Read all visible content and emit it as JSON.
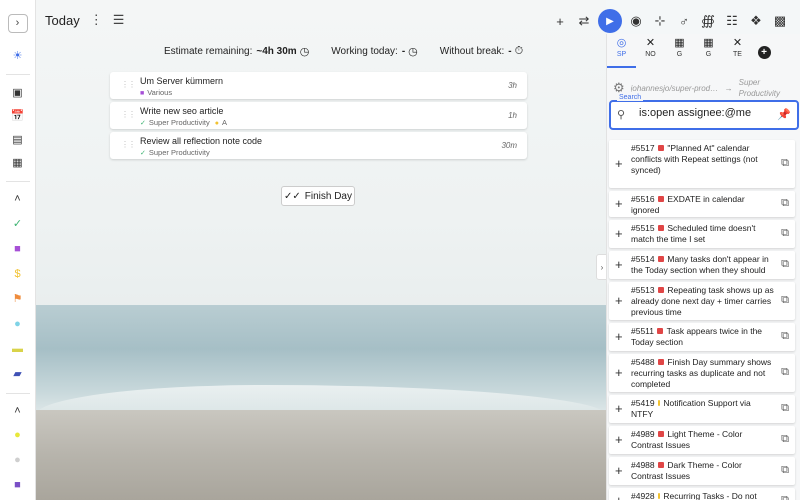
{
  "header": {
    "title": "Today",
    "right_icons": [
      "plus-icon",
      "sync-off-icon",
      "play-icon",
      "focus-mode-icon",
      "walk-icon",
      "meditate-icon",
      "stretch-icon",
      "calendar-sync-icon",
      "plugin-icon",
      "chat-icon"
    ]
  },
  "sidebar": {
    "top": [
      "today-icon",
      "inbox-icon",
      "schedule-icon",
      "planner-icon",
      "boards-icon"
    ],
    "projects": [
      {
        "icon": "check-icon",
        "color": "#3cb371"
      },
      {
        "icon": "folder-icon",
        "color": "#a64fd6"
      },
      {
        "icon": "dollar-icon",
        "color": "#f1c232"
      },
      {
        "icon": "flag-icon",
        "color": "#ef8c3c"
      },
      {
        "icon": "bulb-icon",
        "color": "#7fd3e6"
      },
      {
        "icon": "case-icon",
        "color": "#d9d34a"
      },
      {
        "icon": "car-icon",
        "color": "#3f51b5"
      }
    ],
    "tags": [
      {
        "icon": "tag-icon",
        "color": "#e8e83a"
      },
      {
        "icon": "tag-icon",
        "color": "#cfcfcf"
      },
      {
        "icon": "chat-icon",
        "color": "#7a4fc6"
      }
    ]
  },
  "stats": {
    "estimate_label": "Estimate remaining:",
    "estimate_value": "~4h 30m",
    "working_label": "Working today:",
    "working_value": "-",
    "break_label": "Without break:",
    "break_value": "-"
  },
  "tasks": [
    {
      "title": "Um Server kümmern",
      "tags": [
        {
          "label": "Various",
          "color": "#a64fd6",
          "icon": "folder-icon"
        }
      ],
      "estimate": "3h"
    },
    {
      "title": "Write new seo article",
      "tags": [
        {
          "label": "Super Productivity",
          "color": "#3cb371",
          "icon": "check-icon"
        },
        {
          "label": "A",
          "color": "#f1c232",
          "icon": "tag-icon"
        }
      ],
      "estimate": "1h"
    },
    {
      "title": "Review all reflection note code",
      "tags": [
        {
          "label": "Super Productivity",
          "color": "#3cb371",
          "icon": "check-icon"
        }
      ],
      "estimate": "30m"
    }
  ],
  "finish_day_label": "Finish Day",
  "panel": {
    "providers": [
      {
        "code": "SP",
        "icon": "github-icon",
        "active": true
      },
      {
        "code": "NO",
        "icon": "off-icon",
        "active": false
      },
      {
        "code": "G",
        "icon": "calendar-icon",
        "active": false
      },
      {
        "code": "G",
        "icon": "calendar-icon",
        "active": false
      },
      {
        "code": "TE",
        "icon": "off-icon",
        "active": false
      }
    ],
    "repo": "johannesjo/super-productivity",
    "project": "Super Productivity",
    "search_label": "Search",
    "search_value": "is:open assignee:@me",
    "issues": [
      {
        "text": "#5517 \"Planned At\" calendar conflicts with Repeat settings (not synced)",
        "labels": [
          "#e04646"
        ]
      },
      {
        "text": "#5516 EXDATE in calendar ignored",
        "labels": [
          "#e04646"
        ]
      },
      {
        "text": "#5515 Scheduled time doesn't match the time I set",
        "labels": [
          "#e04646"
        ]
      },
      {
        "text": "#5514 Many tasks don't appear in the Today section when they should",
        "labels": [
          "#e04646"
        ]
      },
      {
        "text": "#5513 Repeating task shows up as already done next day + timer carries previous time",
        "labels": [
          "#e04646"
        ]
      },
      {
        "text": "#5511 Task appears twice in the Today section",
        "labels": [
          "#e04646"
        ]
      },
      {
        "text": "#5488 Finish Day summary shows recurring tasks as duplicate and not completed",
        "labels": [
          "#e04646"
        ]
      },
      {
        "text": "#5419 Notification Support via NTFY",
        "labels": [
          "#f1c232"
        ]
      },
      {
        "text": "#4989 Light Theme - Color Contrast Issues",
        "labels": [
          "#e04646"
        ]
      },
      {
        "text": "#4988 Dark Theme - Color Contrast Issues",
        "labels": [
          "#e04646"
        ]
      },
      {
        "text": "#4928 Recurring Tasks - Do not",
        "labels": [
          "#f1c232"
        ]
      }
    ]
  }
}
